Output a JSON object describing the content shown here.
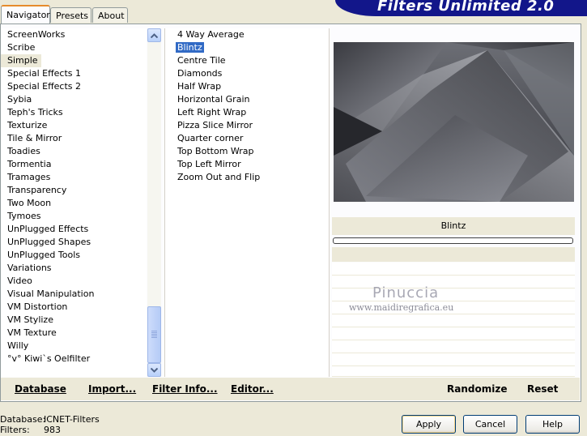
{
  "tabs": [
    "Navigator",
    "Presets",
    "About"
  ],
  "app_title": "Filters Unlimited 2.0",
  "categories": [
    "ScreenWorks",
    "Scribe",
    "Simple",
    "Special Effects 1",
    "Special Effects 2",
    "Sybia",
    "Teph's Tricks",
    "Texturize",
    "Tile & Mirror",
    "Toadies",
    "Tormentia",
    "Tramages",
    "Transparency",
    "Two Moon",
    "Tymoes",
    "UnPlugged Effects",
    "UnPlugged Shapes",
    "UnPlugged Tools",
    "Variations",
    "Video",
    "Visual Manipulation",
    "VM Distortion",
    "VM Stylize",
    "VM Texture",
    "Willy",
    "°v° Kiwi`s Oelfilter"
  ],
  "selected_category": "Simple",
  "filters": [
    "4 Way Average",
    "Blintz",
    "Centre Tile",
    "Diamonds",
    "Half Wrap",
    "Horizontal Grain",
    "Left Right Wrap",
    "Pizza Slice Mirror",
    "Quarter corner",
    "Top Bottom Wrap",
    "Top Left Mirror",
    "Zoom Out and Flip"
  ],
  "selected_filter": "Blintz",
  "preview_filter_name": "Blintz",
  "watermark": {
    "name": "Pinuccia",
    "url": "www.maidiregrafica.eu"
  },
  "bottom_links": {
    "database": "Database",
    "import": "Import...",
    "filter_info": "Filter Info...",
    "editor": "Editor...",
    "randomize": "Randomize",
    "reset": "Reset"
  },
  "status": {
    "database_label": "Database:",
    "database_value": "ICNET-Filters",
    "filters_label": "Filters:",
    "filters_value": "983"
  },
  "buttons": {
    "apply": "Apply",
    "cancel": "Cancel",
    "help": "Help"
  },
  "colors": {
    "banner": "#12168a",
    "selection": "#316ac5",
    "face": "#ece9d8"
  }
}
